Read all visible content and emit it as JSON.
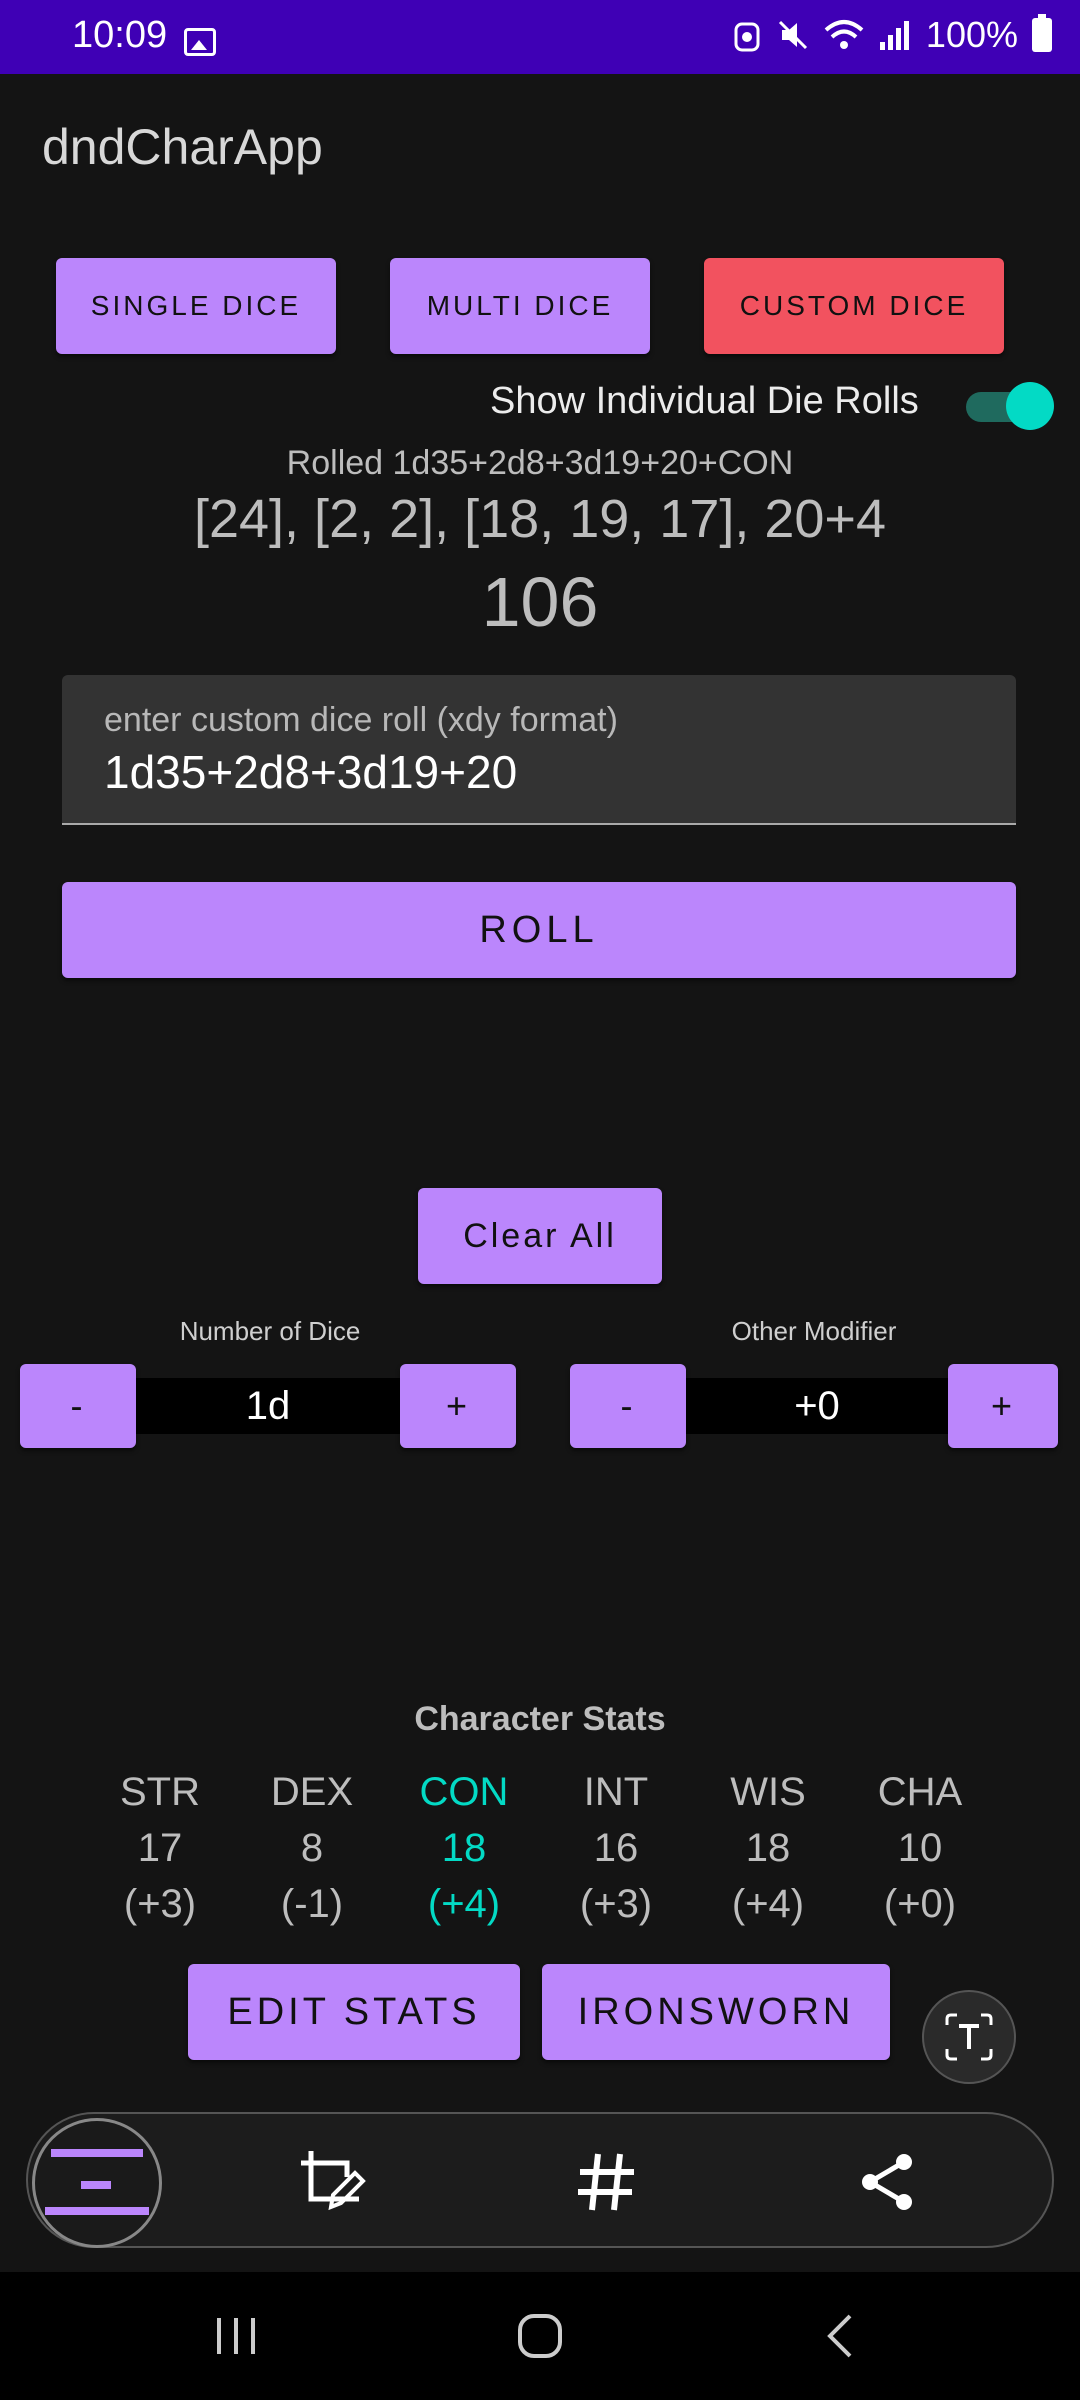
{
  "status_bar": {
    "time": "10:09",
    "battery": "100%"
  },
  "app": {
    "title": "dndCharApp"
  },
  "mode_buttons": {
    "single": "SINGLE DICE",
    "multi": "MULTI DICE",
    "custom": "CUSTOM DICE"
  },
  "toggle": {
    "label": "Show Individual Die Rolls",
    "on": true
  },
  "result": {
    "description": "Rolled 1d35+2d8+3d19+20+CON",
    "dice": "[24], [2, 2], [18, 19, 17], 20+4",
    "total": "106"
  },
  "custom_input": {
    "label": "enter custom dice roll (xdy format)",
    "value": "1d35+2d8+3d19+20"
  },
  "roll_button": "ROLL",
  "clear_button": "Clear All",
  "dice_counter": {
    "label": "Number of Dice",
    "value": "1d",
    "minus": "-",
    "plus": "+"
  },
  "modifier_counter": {
    "label": "Other Modifier",
    "value": "+0",
    "minus": "-",
    "plus": "+"
  },
  "stats": {
    "title": "Character Stats",
    "items": [
      {
        "name": "STR",
        "value": "17",
        "mod": "(+3)"
      },
      {
        "name": "DEX",
        "value": "8",
        "mod": "(-1)"
      },
      {
        "name": "CON",
        "value": "18",
        "mod": "(+4)"
      },
      {
        "name": "INT",
        "value": "16",
        "mod": "(+3)"
      },
      {
        "name": "WIS",
        "value": "18",
        "mod": "(+4)"
      },
      {
        "name": "CHA",
        "value": "10",
        "mod": "(+0)"
      }
    ]
  },
  "bottom_buttons": {
    "edit": "EDIT STATS",
    "ironsworn": "IRONSWORN"
  },
  "colors": {
    "accent": "#bb86fc",
    "custom_active": "#f2525f",
    "teal": "#03dac5",
    "status_bar": "#3f00b5",
    "background": "#141414"
  },
  "icons": {
    "toolbar": [
      "screenshot-thumbnail",
      "crop-edit-icon",
      "hashtag-icon",
      "share-icon"
    ],
    "nav": [
      "recents-icon",
      "home-icon",
      "back-icon"
    ]
  }
}
